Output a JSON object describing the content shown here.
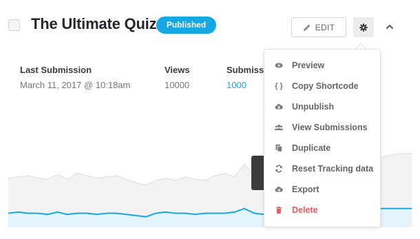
{
  "quiz": {
    "title": "The Ultimate Quiz",
    "status": "Published"
  },
  "toolbar": {
    "edit_label": "EDIT",
    "edit_icon": "pencil-icon",
    "settings_icon": "gear-icon",
    "collapse_icon": "chevron-up-icon"
  },
  "stats": {
    "last_submission_label": "Last Submission",
    "last_submission_value": "March 11, 2017 @ 10:18am",
    "views_label": "Views",
    "views_value": "10000",
    "submissions_label": "Submissi",
    "submissions_value": "1000"
  },
  "chart": {
    "views_series": [
      42,
      43,
      44,
      42,
      41,
      45,
      41,
      46,
      44,
      42,
      43,
      44,
      41,
      38,
      36,
      40,
      42,
      40,
      43,
      41,
      40,
      44,
      46,
      43,
      54,
      44,
      43,
      45,
      41,
      43,
      46,
      44,
      42,
      48,
      50,
      52,
      56,
      58,
      60,
      62,
      63,
      63
    ],
    "submissions_series": [
      12,
      13,
      12,
      12,
      11,
      13,
      11,
      12,
      12,
      11,
      12,
      12,
      11,
      10,
      9,
      12,
      13,
      12,
      12,
      11,
      12,
      12,
      12,
      13,
      16,
      12,
      11,
      12,
      11,
      12,
      14,
      13,
      13,
      14,
      14,
      15,
      15,
      16,
      16,
      16,
      16,
      16
    ],
    "colors": {
      "views": "#e4e4e4",
      "views_fill": "#f3f3f3",
      "submissions": "#17a8e3",
      "submissions_fill": "#e3f4fb"
    }
  },
  "menu": {
    "items": [
      {
        "label": "Preview",
        "icon": "eye-icon"
      },
      {
        "label": "Copy Shortcode",
        "icon": "braces-icon"
      },
      {
        "label": "Unpublish",
        "icon": "cloud-download-icon"
      },
      {
        "label": "View Submissions",
        "icon": "users-icon"
      },
      {
        "label": "Duplicate",
        "icon": "copy-icon"
      },
      {
        "label": "Reset Tracking data",
        "icon": "refresh-icon"
      },
      {
        "label": "Export",
        "icon": "cloud-export-icon"
      },
      {
        "label": "Delete",
        "icon": "trash-icon",
        "color": "#e85a5a"
      }
    ]
  },
  "colors": {
    "accent": "#17a8e3",
    "danger": "#e85a5a"
  }
}
